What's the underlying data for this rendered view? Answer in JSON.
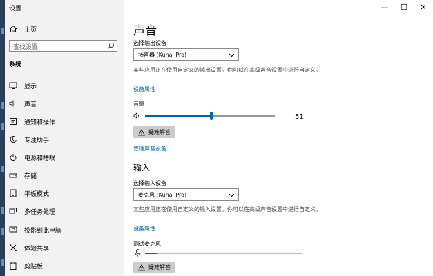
{
  "window": {
    "title": "设置",
    "controls": {
      "minimize": "—",
      "maximize": "☐",
      "close": "✕"
    }
  },
  "sidebar": {
    "home": "主页",
    "search_placeholder": "查找设置",
    "section": "系统",
    "items": [
      {
        "label": "显示",
        "icon": "display-icon"
      },
      {
        "label": "声音",
        "icon": "speaker-icon"
      },
      {
        "label": "通知和操作",
        "icon": "notification-icon"
      },
      {
        "label": "专注助手",
        "icon": "moon-icon"
      },
      {
        "label": "电源和睡眠",
        "icon": "power-icon"
      },
      {
        "label": "存储",
        "icon": "storage-icon"
      },
      {
        "label": "平板模式",
        "icon": "tablet-icon"
      },
      {
        "label": "多任务处理",
        "icon": "multitask-icon"
      },
      {
        "label": "投影到此电脑",
        "icon": "project-icon"
      },
      {
        "label": "体验共享",
        "icon": "share-icon"
      },
      {
        "label": "剪贴板",
        "icon": "clipboard-icon"
      }
    ]
  },
  "main": {
    "title": "声音",
    "output": {
      "device_label": "选择输出设备",
      "device_value": "扬声器 (Kunai Pro)",
      "description": "某些应用正在使用自定义的输出设置。你可以在高级声音设置中进行自定义。",
      "properties_link": "设备属性",
      "volume_label": "音量",
      "volume_value": "51",
      "volume_level": 0.51,
      "troubleshoot": "疑难解答",
      "manage_link": "管理声音设备"
    },
    "input": {
      "heading": "输入",
      "device_label": "选择输入设备",
      "device_value": "麦克风 (Kunai Pro)",
      "description": "某些应用正在使用自定义的输入设置。你可以在高级声音设置中进行自定义。",
      "properties_link": "设备属性",
      "test_label": "测试麦克风",
      "mic_level": 0.08,
      "troubleshoot": "疑难解答"
    }
  },
  "colors": {
    "accent": "#0063b1",
    "sidebar_bg": "#f2f2f2"
  }
}
